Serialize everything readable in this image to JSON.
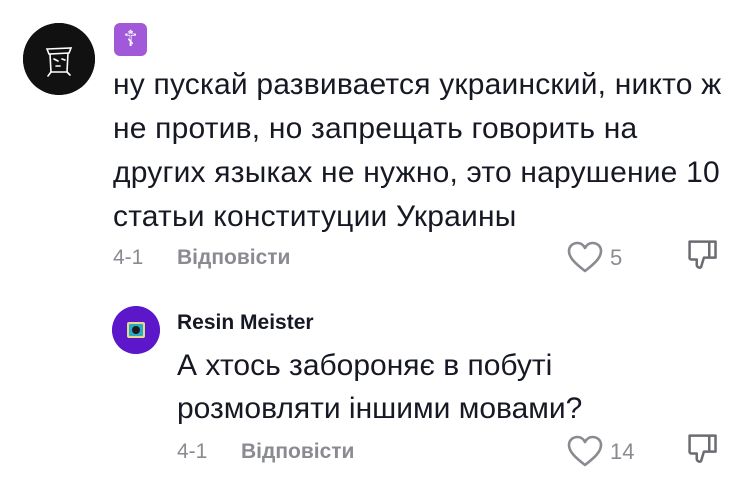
{
  "comment": {
    "badge_symbol": "☦",
    "text": "ну пускай развивается украинский, никто ж не против, но запрещать говорить на других языках не нужно, это нарушение 10 статьи конституции Украины",
    "date": "4-1",
    "reply_label": "Відповісти",
    "like_count": "5"
  },
  "reply": {
    "author": "Resin Meister",
    "text": "А хтось забороняє в побуті розмовляти іншими мовами?",
    "date": "4-1",
    "reply_label": "Відповісти",
    "like_count": "14"
  },
  "icons": {
    "like": "heart-outline-icon",
    "dislike": "thumbs-down-outline-icon"
  }
}
